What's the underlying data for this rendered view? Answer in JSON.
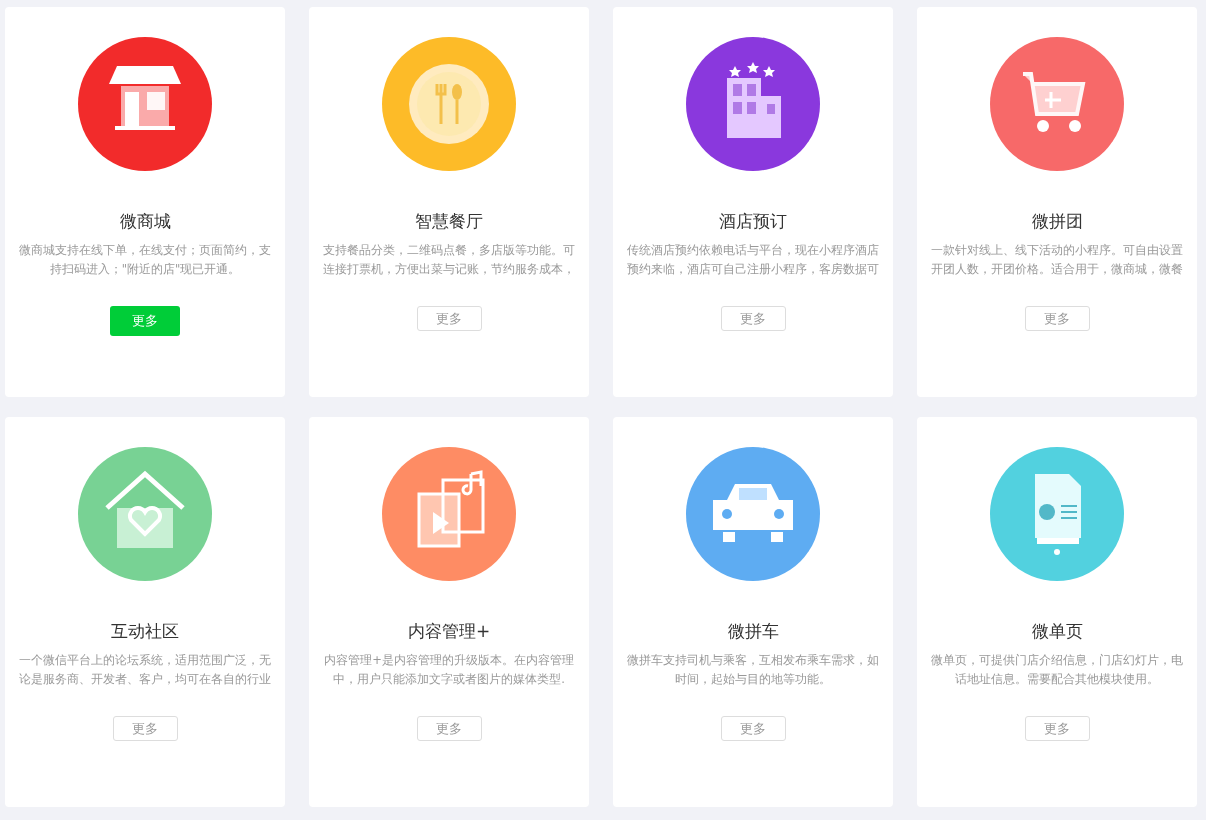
{
  "cards": [
    {
      "kind": "shop",
      "color": "#f22b2b",
      "title": "微商城",
      "description": "微商城支持在线下单，在线支付；页面简约，支持扫码进入；\"附近的店\"现已开通。",
      "button": {
        "label": "更多",
        "selected": true
      }
    },
    {
      "kind": "dish",
      "color": "#fdbb28",
      "title": "智慧餐厅",
      "description": "支持餐品分类，二维码点餐，多店版等功能。可连接打票机，方便出菜与记账，节约服务成本，",
      "button": {
        "label": "更多",
        "selected": false
      }
    },
    {
      "kind": "hotel",
      "color": "#8a38dd",
      "title": "酒店预订",
      "description": "传统酒店预约依赖电话与平台，现在小程序酒店预约来临，酒店可自己注册小程序，客房数据可",
      "button": {
        "label": "更多",
        "selected": false
      }
    },
    {
      "kind": "cart",
      "color": "#f76969",
      "title": "微拼团",
      "description": "一款针对线上、线下活动的小程序。可自由设置开团人数，开团价格。适合用于，微商城，微餐",
      "button": {
        "label": "更多",
        "selected": false
      }
    },
    {
      "kind": "house",
      "color": "#78d294",
      "title": "互动社区",
      "description": "一个微信平台上的论坛系统，适用范围广泛，无论是服务商、开发者、客户，均可在各自的行业",
      "button": {
        "label": "更多",
        "selected": false
      }
    },
    {
      "kind": "media",
      "color": "#fe8c64",
      "title": "内容管理+",
      "description": "内容管理+是内容管理的升级版本。在内容管理中，用户只能添加文字或者图片的媒体类型.",
      "button": {
        "label": "更多",
        "selected": false
      }
    },
    {
      "kind": "car",
      "color": "#5eacf2",
      "title": "微拼车",
      "description": "微拼车支持司机与乘客，互相发布乘车需求，如时间，起始与目的地等功能。",
      "button": {
        "label": "更多",
        "selected": false
      }
    },
    {
      "kind": "page",
      "color": "#52d1df",
      "title": "微单页",
      "description": "微单页，可提供门店介绍信息，门店幻灯片，电话地址信息。需要配合其他模块使用。",
      "button": {
        "label": "更多",
        "selected": false
      }
    }
  ]
}
